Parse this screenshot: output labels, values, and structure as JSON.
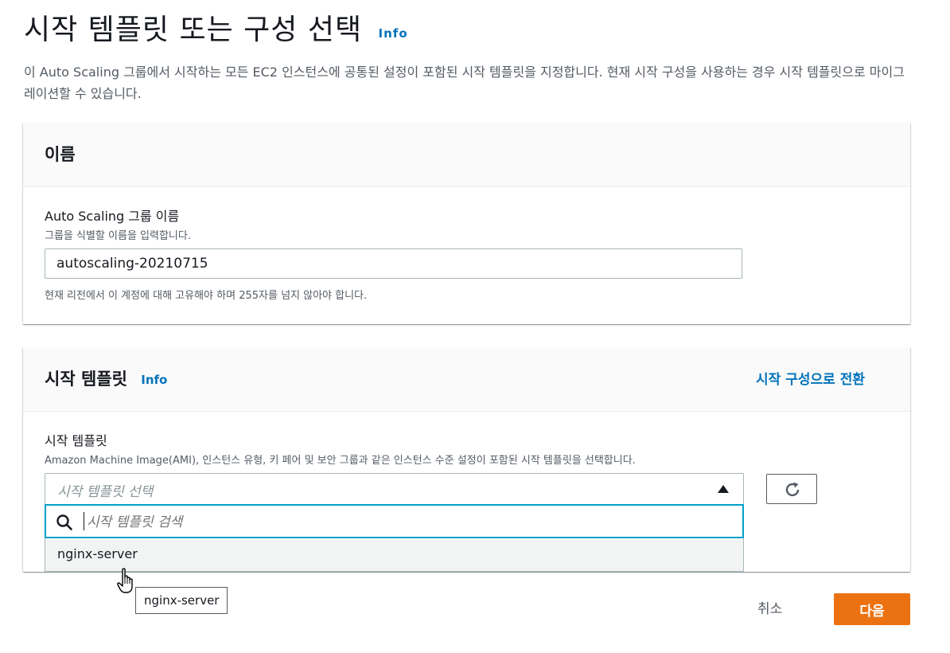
{
  "page": {
    "title": "시작 템플릿 또는 구성 선택",
    "info_label": "Info",
    "description": "이 Auto Scaling 그룹에서 시작하는 모든 EC2 인스턴스에 공통된 설정이 포함된 시작 템플릿을 지정합니다. 현재 시작 구성을 사용하는 경우 시작 템플릿으로 마이그레이션할 수 있습니다."
  },
  "name_panel": {
    "heading": "이름",
    "field_label": "Auto Scaling 그룹 이름",
    "field_description": "그룹을 식별할 이름을 입력합니다.",
    "field_value": "autoscaling-20210715",
    "constraint": "현재 리전에서 이 계정에 대해 고유해야 하며 255자를 넘지 않아야 합니다."
  },
  "template_panel": {
    "heading": "시작 템플릿",
    "info_label": "Info",
    "switch_link": "시작 구성으로 전환",
    "field_label": "시작 템플릿",
    "field_description": "Amazon Machine Image(AMI), 인스턴스 유형, 키 페어 및 보안 그룹과 같은 인스턴스 수준 설정이 포함된 시작 템플릿을 선택합니다.",
    "select_placeholder": "시작 템플릿 선택",
    "search_placeholder": "시작 템플릿 검색",
    "options": [
      "nginx-server"
    ],
    "tooltip": "nginx-server"
  },
  "footer": {
    "cancel_label": "취소",
    "next_label": "다음"
  },
  "colors": {
    "primary_button": "#ec7211",
    "link": "#0073bb",
    "focus_ring": "#00a1c9"
  },
  "icons": [
    "caret-up-icon",
    "refresh-icon",
    "search-icon",
    "hand-pointer-cursor-icon"
  ]
}
